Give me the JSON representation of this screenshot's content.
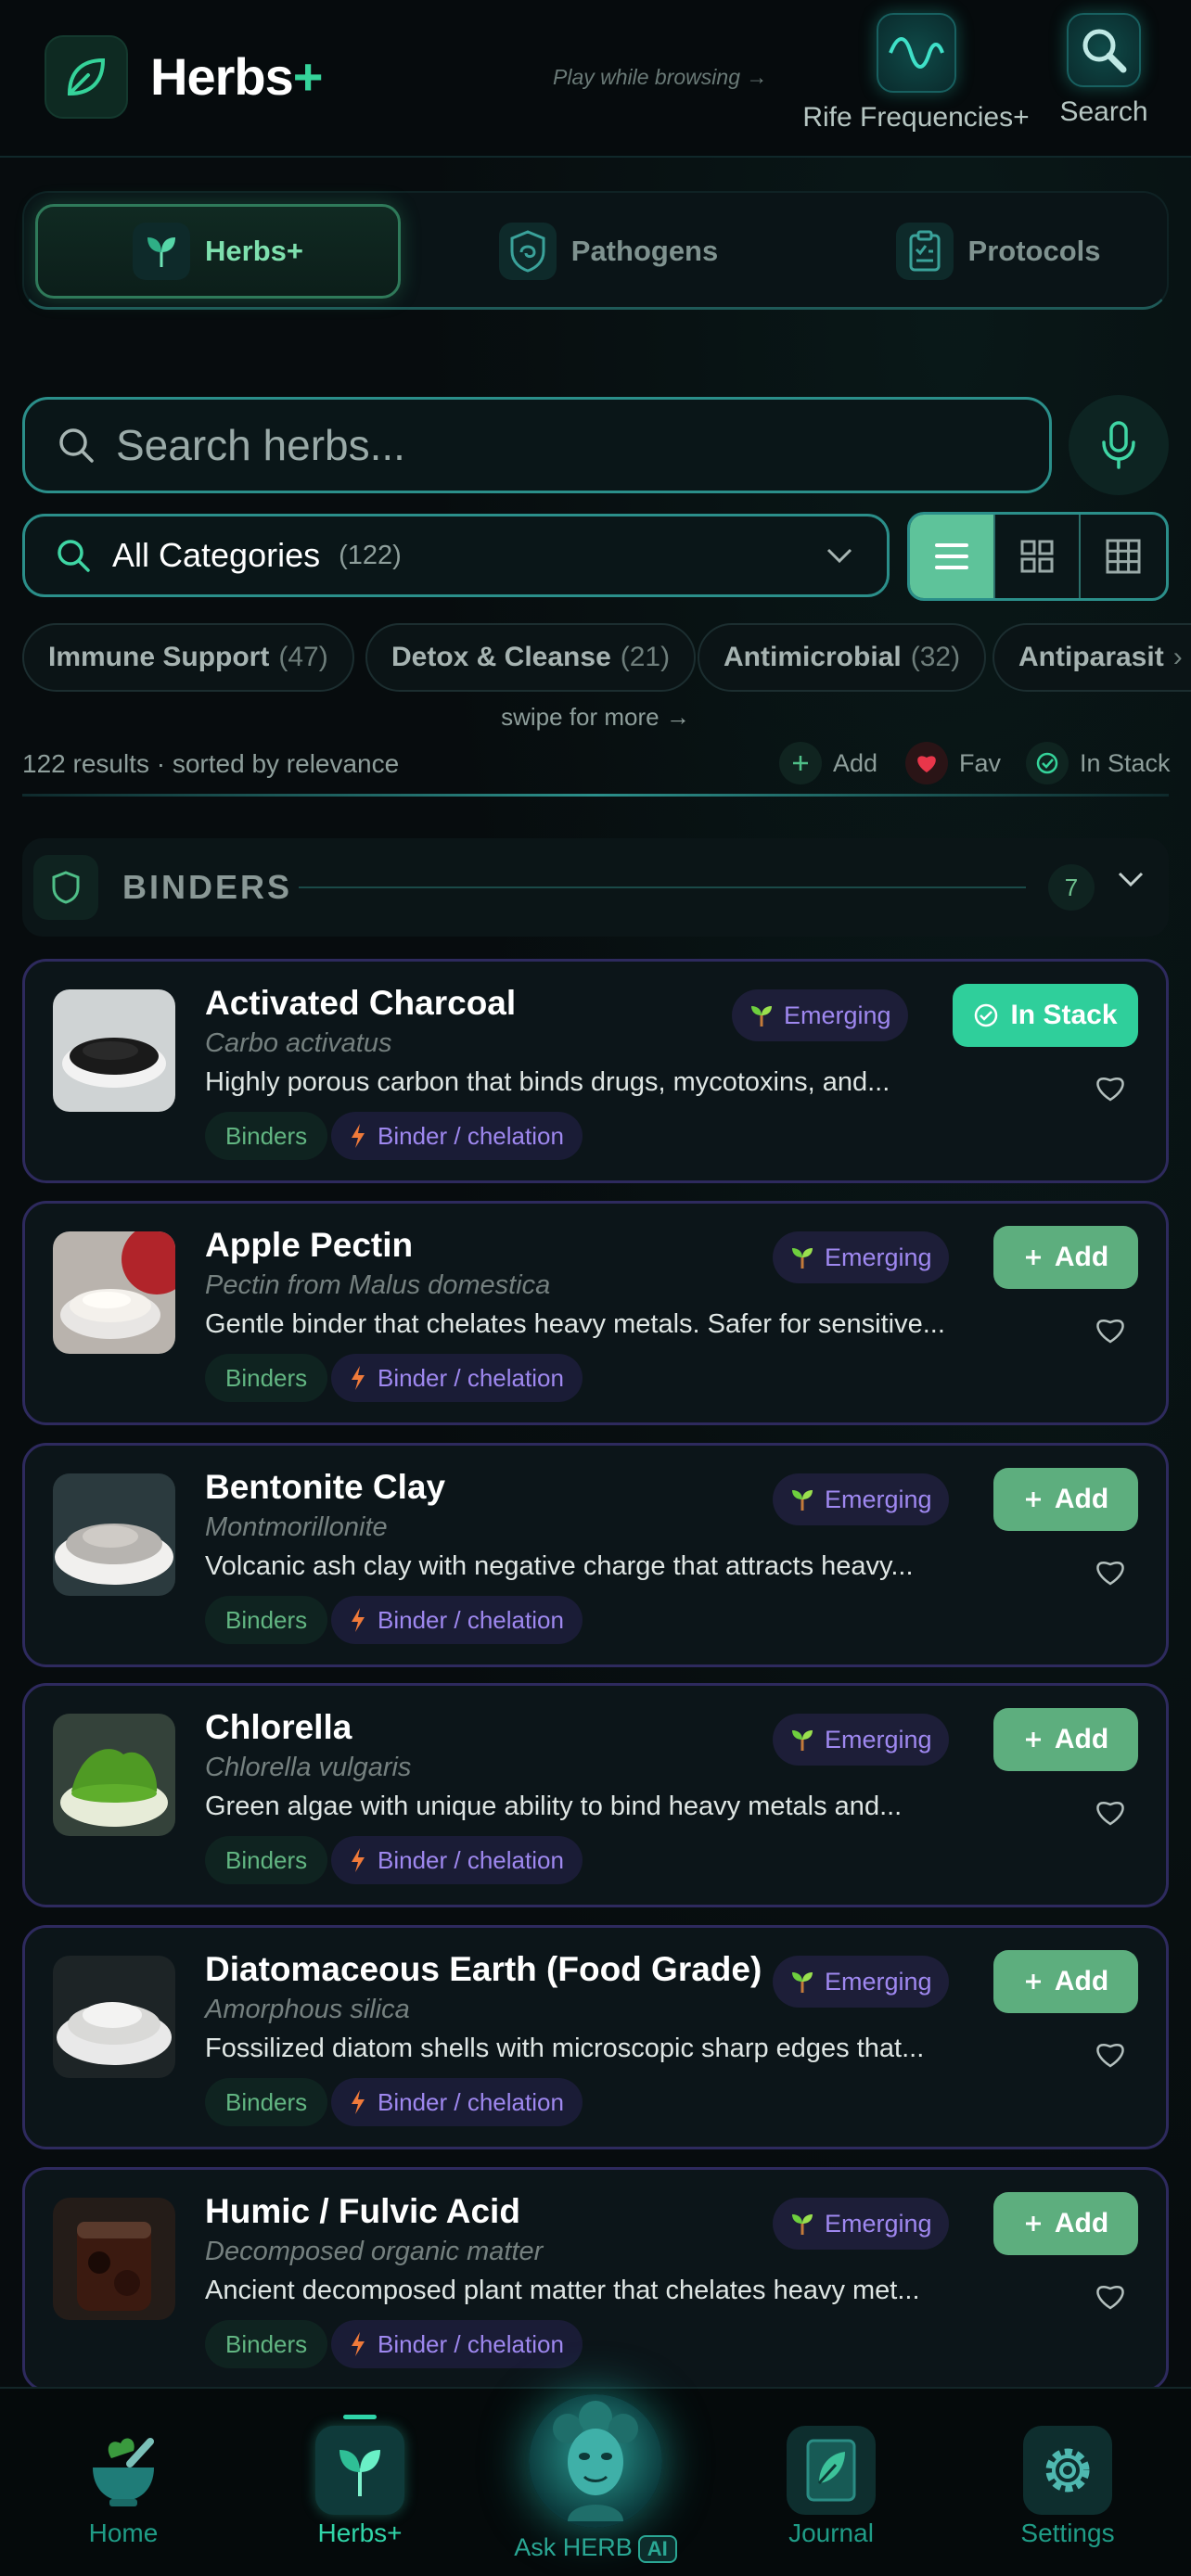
{
  "header": {
    "title": "Herbs",
    "title_plus": "+",
    "play_hint": "Play while browsing →",
    "rife_label": "Rife Frequencies+",
    "search_label": "Search"
  },
  "tabs": [
    {
      "label": "Herbs+"
    },
    {
      "label": "Pathogens"
    },
    {
      "label": "Protocols"
    }
  ],
  "search": {
    "placeholder": "Search herbs..."
  },
  "categories": {
    "selected": "All Categories",
    "count": "(122)"
  },
  "chips": [
    {
      "label": "Immune Support",
      "count": "(47)"
    },
    {
      "label": "Detox & Cleanse",
      "count": "(21)"
    },
    {
      "label": "Antimicrobial",
      "count": "(32)"
    },
    {
      "label": "Antiparasit",
      "count": "›"
    }
  ],
  "swipe_hint": "swipe for more →",
  "results_text": "122 results · sorted by relevance",
  "legend": {
    "add": "Add",
    "fav": "Fav",
    "in_stack": "In Stack"
  },
  "section": {
    "title": "BINDERS",
    "count": "7"
  },
  "herbs": [
    {
      "name": "Activated Charcoal",
      "latin": "Carbo activatus",
      "desc": "Highly porous carbon that binds drugs, mycotoxins, and...",
      "tag": "Binders",
      "mechanism": "Binder / chelation",
      "status": "Emerging",
      "action": "In Stack",
      "image": "charcoal"
    },
    {
      "name": "Apple Pectin",
      "latin": "Pectin from Malus domestica",
      "desc": "Gentle binder that chelates heavy metals. Safer for sensitive...",
      "tag": "Binders",
      "mechanism": "Binder / chelation",
      "status": "Emerging",
      "action": "Add",
      "image": "pectin"
    },
    {
      "name": "Bentonite Clay",
      "latin": "Montmorillonite",
      "desc": "Volcanic ash clay with negative charge that attracts heavy...",
      "tag": "Binders",
      "mechanism": "Binder / chelation",
      "status": "Emerging",
      "action": "Add",
      "image": "clay"
    },
    {
      "name": "Chlorella",
      "latin": "Chlorella vulgaris",
      "desc": "Green algae with unique ability to bind heavy metals and...",
      "tag": "Binders",
      "mechanism": "Binder / chelation",
      "status": "Emerging",
      "action": "Add",
      "image": "chlorella"
    },
    {
      "name": "Diatomaceous Earth (Food Grade)",
      "latin": "Amorphous silica",
      "desc": "Fossilized diatom shells with microscopic sharp edges that...",
      "tag": "Binders",
      "mechanism": "Binder / chelation",
      "status": "Emerging",
      "action": "Add",
      "image": "diatom"
    },
    {
      "name": "Humic / Fulvic Acid",
      "latin": "Decomposed organic matter",
      "desc": "Ancient decomposed plant matter that chelates heavy met...",
      "tag": "Binders",
      "mechanism": "Binder / chelation",
      "status": "Emerging",
      "action": "Add",
      "image": "humic"
    }
  ],
  "bottom_nav": [
    {
      "label": "Home"
    },
    {
      "label": "Herbs+"
    },
    {
      "label": "Ask HERB",
      "badge": "AI"
    },
    {
      "label": "Journal"
    },
    {
      "label": "Settings"
    }
  ],
  "colors": {
    "accent": "#35d39a",
    "teal_border": "#2b8f8a",
    "card_border": "#2e2a5e",
    "add_button": "#5dae7e",
    "in_stack_button": "#2fcf9b",
    "status_purple": "#9f88f0"
  }
}
